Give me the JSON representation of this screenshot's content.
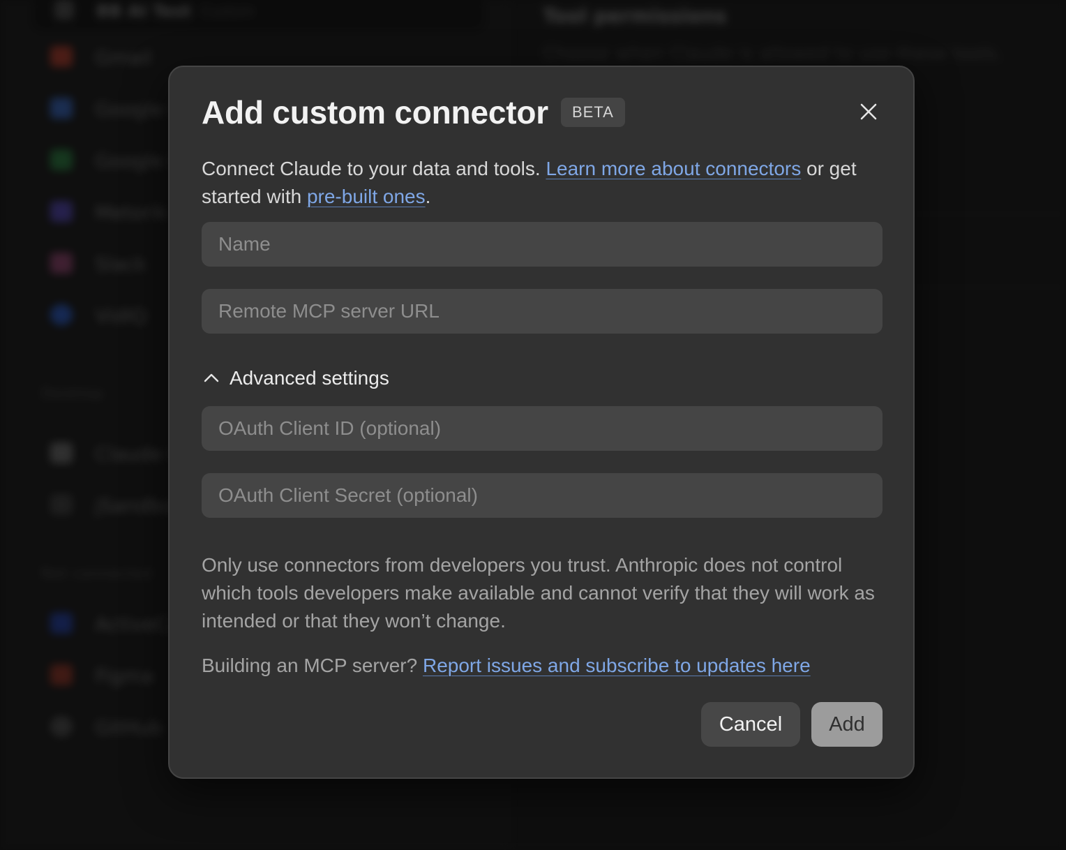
{
  "background": {
    "top_row": {
      "title": "BB AI Test",
      "tag": "Custom"
    },
    "connectors": [
      {
        "label": "Gmail",
        "icon": "gmail-icon",
        "color": "#c2412f"
      },
      {
        "label": "Google Calendar",
        "icon": "google-calendar-icon",
        "color": "#3b6fd1"
      },
      {
        "label": "Google Drive",
        "icon": "google-drive-icon",
        "color": "#2e8b46"
      },
      {
        "label": "Metorik",
        "icon": "metorik-icon",
        "color": "#5a4cc4"
      },
      {
        "label": "Slack",
        "icon": "slack-icon",
        "color": "#a04a7a"
      },
      {
        "label": "VidIQ",
        "icon": "vidiq-icon",
        "color": "#2e63d8"
      }
    ],
    "desktop_section": "Desktop",
    "desktop_items": [
      {
        "label": "Claude Code",
        "icon": "claude-code-icon",
        "color": "#777777"
      },
      {
        "label": "jSandbox",
        "icon": "jsandbox-icon",
        "color": "#444444"
      }
    ],
    "not_connected_section": "Not connected",
    "not_connected_items": [
      {
        "label": "ActiveCampaign",
        "icon": "activecampaign-icon",
        "color": "#2746b8"
      },
      {
        "label": "Figma",
        "icon": "figma-icon",
        "color": "#a33a2a"
      },
      {
        "label": "GitHub",
        "icon": "github-icon",
        "color": "#555555"
      }
    ],
    "right_title": "Tool permissions",
    "right_subtitle": "Choose when Claude is allowed to use these tools."
  },
  "modal": {
    "title": "Add custom connector",
    "badge": "BETA",
    "intro_text_1": "Connect Claude to your data and tools. ",
    "intro_link_1": "Learn more about connectors",
    "intro_text_2": " or get started with ",
    "intro_link_2": "pre-built ones",
    "intro_text_3": ".",
    "fields": {
      "name_placeholder": "Name",
      "url_placeholder": "Remote MCP server URL",
      "client_id_placeholder": "OAuth Client ID (optional)",
      "client_secret_placeholder": "OAuth Client Secret (optional)"
    },
    "advanced_label": "Advanced settings",
    "warning": "Only use connectors from developers you trust. Anthropic does not control which tools developers make available and cannot verify that they will work as intended or that they won’t change.",
    "footer_text": "Building an MCP server? ",
    "footer_link": "Report issues and subscribe to updates here",
    "cancel_label": "Cancel",
    "add_label": "Add"
  },
  "colors": {
    "modal_bg": "#313131",
    "field_bg": "#454545",
    "link": "#7fa7e6",
    "add_button_disabled": "#9c9c9c"
  }
}
